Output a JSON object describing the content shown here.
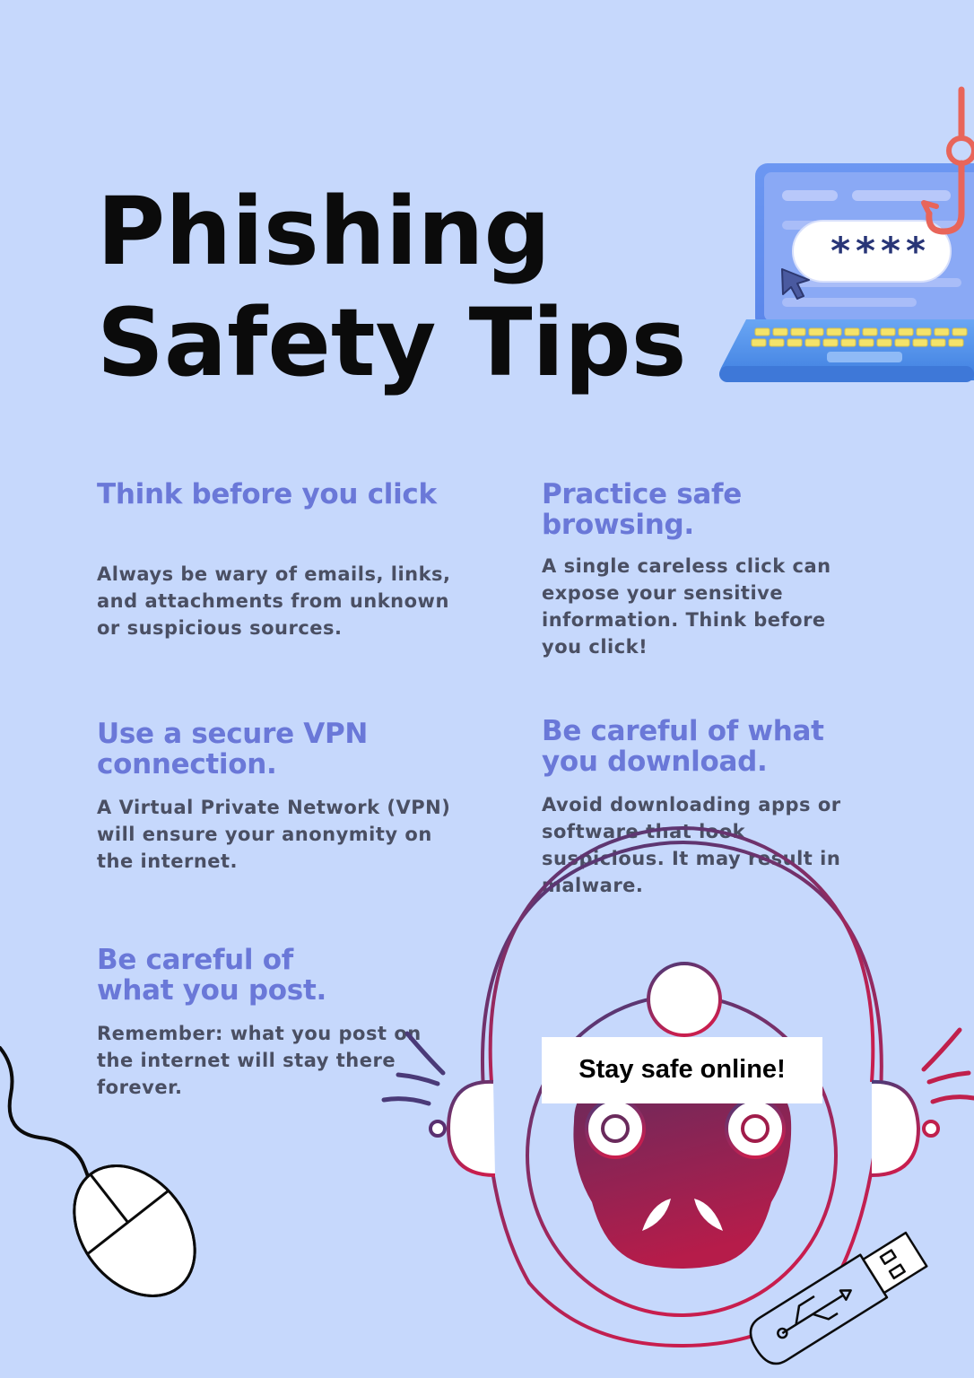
{
  "title": {
    "line1": "Phishing",
    "line2": "Safety Tips"
  },
  "tips": [
    {
      "heading": "Think before you click",
      "body": "Always be wary of emails, links, and attachments from unknown or suspicious sources."
    },
    {
      "heading": "Practice safe browsing.",
      "body": "A single careless click can expose your sensitive information. Think before you click!"
    },
    {
      "heading": "Use a secure VPN connection.",
      "body": "A Virtual Private Network (VPN) will ensure your anonymity on the internet."
    },
    {
      "heading": "Be careful of what you download.",
      "body": "Avoid downloading apps or software that look suspicious. It may result in malware."
    },
    {
      "heading": "Be careful of what you post.",
      "body": "Remember: what you post on the internet will stay there forever."
    }
  ],
  "callout": "Stay safe online!",
  "password_mask": "****",
  "colors": {
    "background": "#c6d8fc",
    "heading": "#6a78d8",
    "body_text": "#4a4f63",
    "title": "#0b0b0b",
    "mascot_gradient_top": "#4a3a78",
    "mascot_gradient_bottom": "#c81e4e"
  },
  "icons": [
    "laptop-phishing-hook-icon",
    "computer-mouse-icon",
    "usb-drive-icon",
    "hacker-mascot-icon"
  ]
}
